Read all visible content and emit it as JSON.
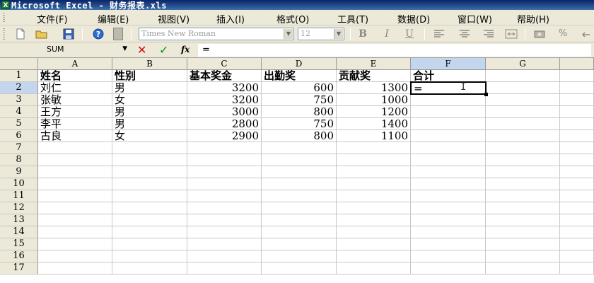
{
  "window": {
    "title": "Microsoft Excel - 财务报表.xls",
    "icon_name": "excel-app-icon"
  },
  "menu": [
    {
      "label": "文件(F)"
    },
    {
      "label": "编辑(E)"
    },
    {
      "label": "视图(V)"
    },
    {
      "label": "插入(I)"
    },
    {
      "label": "格式(O)"
    },
    {
      "label": "工具(T)"
    },
    {
      "label": "数据(D)"
    },
    {
      "label": "窗口(W)"
    },
    {
      "label": "帮助(H)"
    }
  ],
  "toolbar": {
    "font_name": "Times New Roman",
    "font_size": "12",
    "bold_label": "B",
    "italic_label": "I",
    "underline_label": "U",
    "percent_label": "%"
  },
  "formula_bar": {
    "name_box": "SUM",
    "fx_label": "fx",
    "formula": "="
  },
  "sheet": {
    "columns": [
      "A",
      "B",
      "C",
      "D",
      "E",
      "F",
      "G"
    ],
    "selected_column": "F",
    "row_numbers": [
      "1",
      "2",
      "3",
      "4",
      "5",
      "6",
      "7",
      "8",
      "9",
      "10",
      "11",
      "12",
      "13",
      "14",
      "15",
      "16",
      "17"
    ],
    "selected_row": "2",
    "header_row": [
      "姓名",
      "性别",
      "基本奖金",
      "出勤奖",
      "贡献奖",
      "合计"
    ],
    "rows": [
      [
        "刘仁",
        "男",
        "3200",
        "600",
        "1300"
      ],
      [
        "张敏",
        "女",
        "3200",
        "750",
        "1000"
      ],
      [
        "王方",
        "男",
        "3000",
        "800",
        "1200"
      ],
      [
        "李平",
        "男",
        "2800",
        "750",
        "1400"
      ],
      [
        "古良",
        "女",
        "2900",
        "800",
        "1100"
      ]
    ],
    "active_cell": {
      "ref": "F2",
      "value": "="
    }
  },
  "colors": {
    "title_bar": "#0a246a",
    "chrome": "#ece9d8",
    "header_selected": "#c4d5ee"
  }
}
